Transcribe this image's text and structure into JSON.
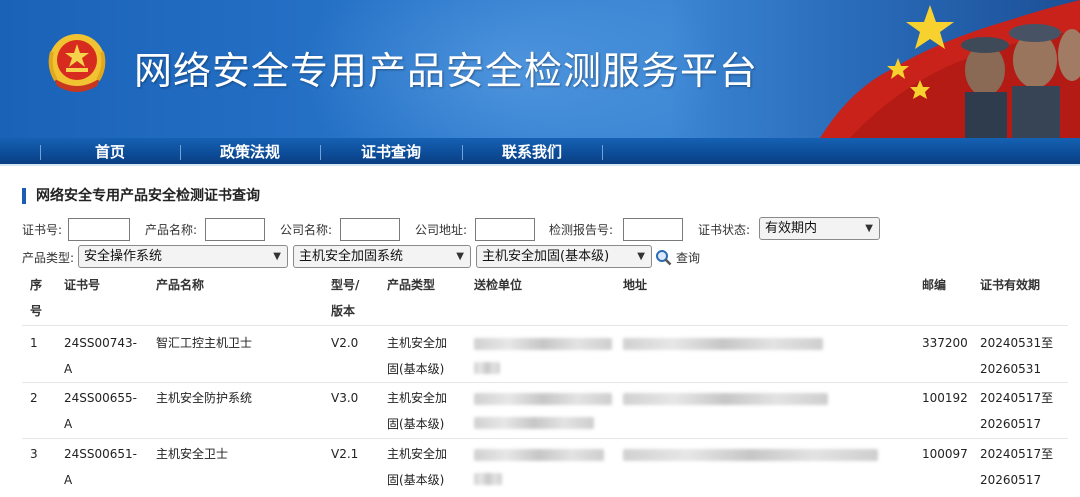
{
  "header": {
    "title": "网络安全专用产品安全检测服务平台"
  },
  "nav": {
    "items": [
      "首页",
      "政策法规",
      "证书查询",
      "联系我们"
    ]
  },
  "section": {
    "title": "网络安全专用产品安全检测证书查询"
  },
  "filters": {
    "cert_no_label": "证书号:",
    "product_name_label": "产品名称:",
    "company_name_label": "公司名称:",
    "company_addr_label": "公司地址:",
    "report_no_label": "检测报告号:",
    "status_label": "证书状态:",
    "status_value": "有效期内",
    "product_type_label": "产品类型:",
    "type1_value": "安全操作系统",
    "type2_value": "主机安全加固系统",
    "type3_value": "主机安全加固(基本级)",
    "search_label": "查询"
  },
  "table": {
    "headers": {
      "seq_1": "序",
      "seq_2": "号",
      "cert_no": "证书号",
      "product_name": "产品名称",
      "model_1": "型号/",
      "model_2": "版本",
      "product_type": "产品类型",
      "submit_unit": "送检单位",
      "address": "地址",
      "postcode": "邮编",
      "validity": "证书有效期"
    },
    "rows": [
      {
        "seq": "1",
        "cert_1": "24SS00743-",
        "cert_2": "A",
        "name": "智汇工控主机卫士",
        "model": "V2.0",
        "type_1": "主机安全加",
        "type_2": "固(基本级)",
        "postcode": "337200",
        "valid_1": "20240531至",
        "valid_2": "20260531"
      },
      {
        "seq": "2",
        "cert_1": "24SS00655-",
        "cert_2": "A",
        "name": "主机安全防护系统",
        "model": "V3.0",
        "type_1": "主机安全加",
        "type_2": "固(基本级)",
        "postcode": "100192",
        "valid_1": "20240517至",
        "valid_2": "20260517"
      },
      {
        "seq": "3",
        "cert_1": "24SS00651-",
        "cert_2": "A",
        "name": "主机安全卫士",
        "model": "V2.1",
        "type_1": "主机安全加",
        "type_2": "固(基本级)",
        "postcode": "100097",
        "valid_1": "20240517至",
        "valid_2": "20260517"
      }
    ]
  },
  "icons": {
    "emblem": "national-emblem-icon",
    "search": "magnifier-icon",
    "flag": "red-flag-icon"
  },
  "colors": {
    "banner": "#2a78cc",
    "nav": "#0d4e9a",
    "accent": "#1a5fb4"
  }
}
